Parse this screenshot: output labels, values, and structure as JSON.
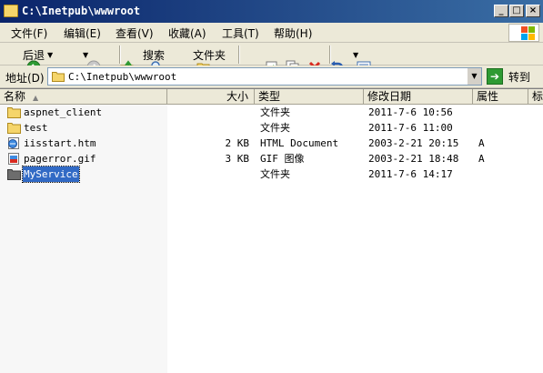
{
  "window": {
    "title": "C:\\Inetpub\\wwwroot",
    "buttons": [
      "_",
      "□",
      "×"
    ]
  },
  "menu": [
    {
      "label": "文件(F)"
    },
    {
      "label": "编辑(E)"
    },
    {
      "label": "查看(V)"
    },
    {
      "label": "收藏(A)"
    },
    {
      "label": "工具(T)"
    },
    {
      "label": "帮助(H)"
    }
  ],
  "toolbar": {
    "back_label": "后退",
    "search_label": "搜索",
    "folders_label": "文件夹",
    "icons": [
      "back-icon",
      "forward-icon",
      "up-folder-icon",
      "search-icon",
      "folders-icon",
      "move-to-icon",
      "copy-to-icon",
      "delete-icon",
      "undo-icon",
      "views-icon"
    ]
  },
  "address": {
    "label": "地址(D)",
    "value": "C:\\Inetpub\\wwwroot",
    "go_label": "转到"
  },
  "columns": [
    {
      "label": "名称"
    },
    {
      "label": "大小"
    },
    {
      "label": "类型"
    },
    {
      "label": "修改日期"
    },
    {
      "label": "属性"
    },
    {
      "label": "标"
    }
  ],
  "files": [
    {
      "name": "aspnet_client",
      "size": "",
      "type": "文件夹",
      "date": "2011-7-6 10:56",
      "attr": "",
      "icon": "folder-icon"
    },
    {
      "name": "test",
      "size": "",
      "type": "文件夹",
      "date": "2011-7-6 11:00",
      "attr": "",
      "icon": "folder-icon"
    },
    {
      "name": "iisstart.htm",
      "size": "2 KB",
      "type": "HTML Document",
      "date": "2003-2-21 20:15",
      "attr": "A",
      "icon": "html-file-icon"
    },
    {
      "name": "pagerror.gif",
      "size": "3 KB",
      "type": "GIF 图像",
      "date": "2003-2-21 18:48",
      "attr": "A",
      "icon": "gif-file-icon"
    },
    {
      "name": "MyService",
      "size": "",
      "type": "文件夹",
      "date": "2011-7-6 14:17",
      "attr": "",
      "icon": "folder-icon",
      "selected": true
    }
  ],
  "colors": {
    "title_gradient_start": "#0a246a",
    "title_gradient_end": "#3a6ea5",
    "selection": "#316ac5",
    "chrome": "#ece9d8"
  }
}
